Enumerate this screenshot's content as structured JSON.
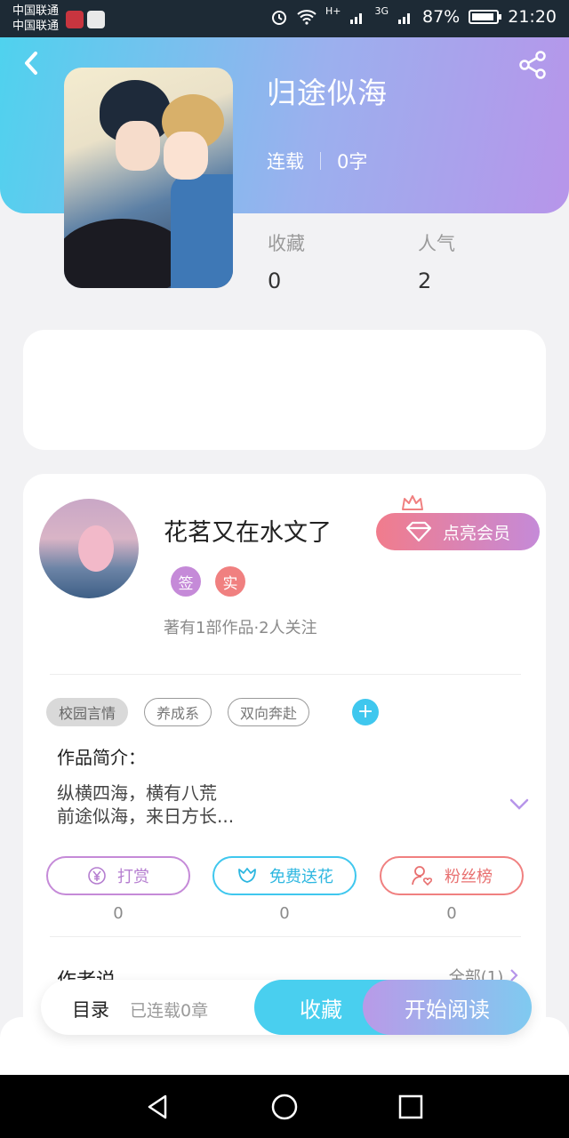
{
  "status_bar": {
    "carrier_1": "中国联通",
    "carrier_2": "中国联通",
    "network_h": "H+",
    "network_3g": "3G",
    "battery": "87%",
    "time": "21:20"
  },
  "header": {
    "back_icon": "chevron-left-icon",
    "share_icon": "share-icon",
    "colors": {
      "gradient_start": "#4fd2ee",
      "gradient_end": "#b795ea"
    }
  },
  "book": {
    "title": "归途似海",
    "status": "连载",
    "word_count": "0字",
    "stats": [
      {
        "label": "收藏",
        "value": "0"
      },
      {
        "label": "人气",
        "value": "2"
      }
    ]
  },
  "author": {
    "name": "花茗又在水文了",
    "vip_button": "点亮会员",
    "badges": [
      "签",
      "实"
    ],
    "works_info": "著有1部作品·2人关注"
  },
  "tags": [
    "校园言情",
    "养成系",
    "双向奔赴"
  ],
  "tag_add": "+",
  "intro": {
    "heading": "作品简介：",
    "line_1": "纵横四海，横有八荒",
    "line_2": "前途似海，来日方长..."
  },
  "actions": [
    {
      "label": "打赏",
      "count": "0",
      "icon": "yuan-icon"
    },
    {
      "label": "免费送花",
      "count": "0",
      "icon": "flower-icon"
    },
    {
      "label": "粉丝榜",
      "count": "0",
      "icon": "fan-heart-icon"
    }
  ],
  "author_say": {
    "heading": "作者说",
    "all_link": "全部(1)"
  },
  "bottom_bar": {
    "toc": "目录",
    "serial_info": "已连载0章",
    "favorite": "收藏",
    "start_reading": "开始阅读"
  }
}
